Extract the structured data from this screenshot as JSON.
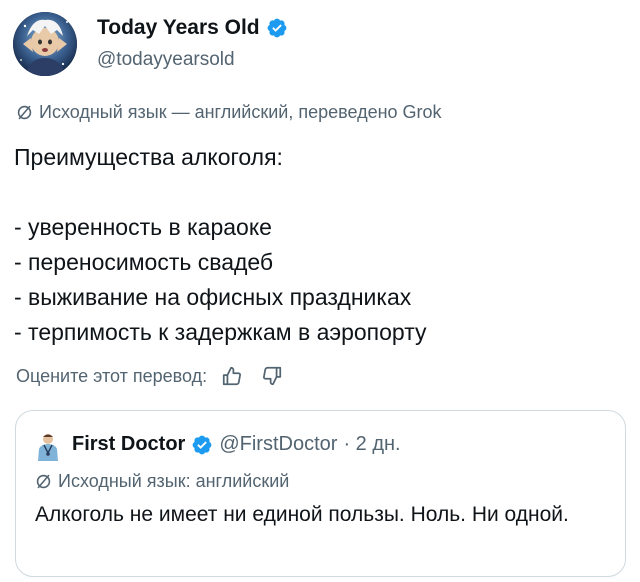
{
  "author": {
    "name": "Today Years Old",
    "handle": "@todayyearsold",
    "verified": true
  },
  "translation_note": "Исходный язык — английский, переведено Grok",
  "tweet_lines": [
    "Преимущества алкоголя:",
    "",
    "- уверенность в караоке",
    "- переносимость свадеб",
    "- выживание на офисных праздниках",
    "- терпимость к задержкам в аэропорту"
  ],
  "rating": {
    "label": "Оцените этот перевод:",
    "like_icon": "thumbs-up-icon",
    "dislike_icon": "thumbs-down-icon"
  },
  "quote": {
    "name": "First Doctor",
    "handle": "@FirstDoctor",
    "time": "· 2 дн.",
    "verified": true,
    "translation_note": "Исходный язык: английский",
    "text": "Алкоголь не имеет ни единой пользы. Ноль. Ни одной."
  },
  "colors": {
    "verified": "#1d9bf0",
    "secondary_text": "#536471",
    "border": "#cfd9de"
  }
}
